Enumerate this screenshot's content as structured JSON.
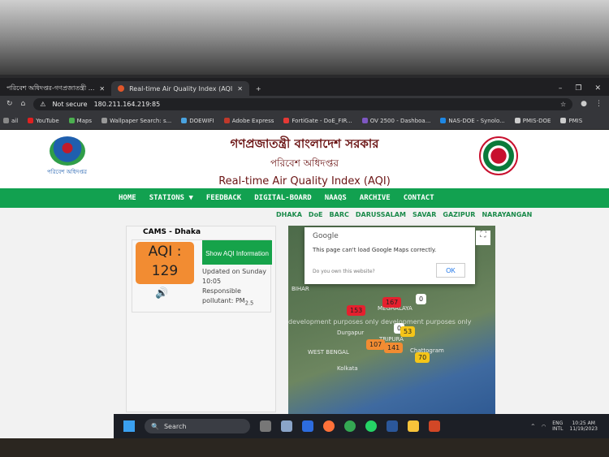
{
  "browser": {
    "tabs": [
      {
        "label": "পরিবেশ অধিদপ্তর-গণপ্রজাতন্ত্রী ..."
      },
      {
        "label": "Real-time Air Quality Index (AQI"
      }
    ],
    "new_tab": "+",
    "url_security": "Not secure",
    "url": "180.211.164.219:85",
    "bookmarks": [
      "ail",
      "YouTube",
      "Maps",
      "Wallpaper Search: s...",
      "DOEWIFI",
      "Adobe Express",
      "FortiGate - DoE_FIR...",
      "OV 2500 - Dashboa...",
      "NAS-DOE - Synolo...",
      "PMIS-DOE",
      "PMIS"
    ]
  },
  "header": {
    "title_bn": "গণপ্রজাতন্ত্রী বাংলাদেশ সরকার",
    "subtitle_bn": "পরিবেশ অধিদপ্তর",
    "title_en": "Real-time Air Quality Index (AQI)",
    "logo_text": "পরিবেশ অধিদপ্তর"
  },
  "nav": {
    "items": [
      "HOME",
      "STATIONS ▼",
      "FEEDBACK",
      "DIGITAL-BOARD",
      "NAAQS",
      "ARCHIVE",
      "CONTACT"
    ]
  },
  "stations": [
    "DHAKA",
    "DoE",
    "BARC",
    "DARUSSALAM",
    "SAVAR",
    "GAZIPUR",
    "NARAYANGAN"
  ],
  "station_card": {
    "name": "CAMS - Dhaka",
    "aqi_label": "AQI :",
    "aqi_value": "129",
    "aqi_color": "#f28c32",
    "button": "Show AQI Information",
    "updated": "Updated on Sunday 10:05",
    "pollutant_label": "Responsible pollutant: PM",
    "pollutant_sub": "2.5"
  },
  "map": {
    "dialog_title": "Google",
    "dialog_message": "This page can't load Google Maps correctly.",
    "dialog_question": "Do you own this website?",
    "ok": "OK",
    "watermark": "development purposes only    development purposes only",
    "labels": [
      "BIHAR",
      "MEGHALAYA",
      "WEST BENGAL",
      "Kolkata",
      "TRIPURA",
      "Chattogram",
      "Durgapur"
    ],
    "markers": [
      {
        "value": "153",
        "color": "#e5202e"
      },
      {
        "value": "167",
        "color": "#e5202e"
      },
      {
        "value": "0",
        "color": "#ffffff"
      },
      {
        "value": "0",
        "color": "#ffffff"
      },
      {
        "value": "53",
        "color": "#f5c518"
      },
      {
        "value": "107",
        "color": "#f28c32"
      },
      {
        "value": "141",
        "color": "#f28c32"
      },
      {
        "value": "70",
        "color": "#f5c518"
      }
    ]
  },
  "taskbar": {
    "search": "Search",
    "lang1": "ENG",
    "lang2": "INTL",
    "time": "10:25 AM",
    "date": "11/19/2023"
  }
}
